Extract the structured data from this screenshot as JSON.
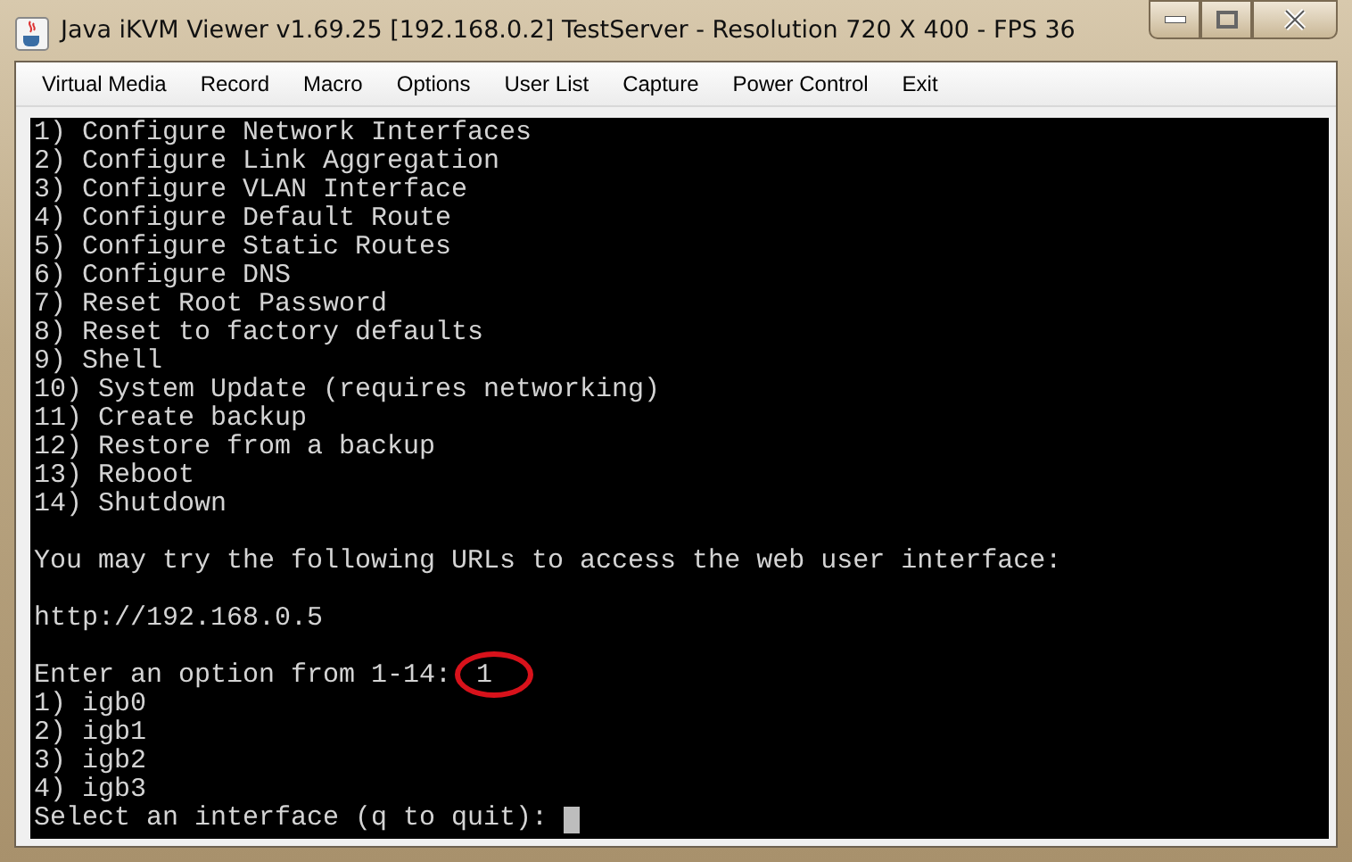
{
  "window": {
    "title": "Java iKVM Viewer v1.69.25 [192.168.0.2] TestServer - Resolution 720 X 400 - FPS 36"
  },
  "menu": [
    "Virtual Media",
    "Record",
    "Macro",
    "Options",
    "User List",
    "Capture",
    "Power Control",
    "Exit"
  ],
  "console": {
    "options": [
      "1) Configure Network Interfaces",
      "2) Configure Link Aggregation",
      "3) Configure VLAN Interface",
      "4) Configure Default Route",
      "5) Configure Static Routes",
      "6) Configure DNS",
      "7) Reset Root Password",
      "8) Reset to factory defaults",
      "9) Shell",
      "10) System Update (requires networking)",
      "11) Create backup",
      "12) Restore from a backup",
      "13) Reboot",
      "14) Shutdown"
    ],
    "message": "You may try the following URLs to access the web user interface:",
    "url": "http://192.168.0.5",
    "prompt": "Enter an option from 1-14:",
    "answer": "1",
    "answer_circled": true,
    "interfaces": [
      "1) igb0",
      "2) igb1",
      "3) igb2",
      "4) igb3"
    ],
    "final_prompt": "Select an interface (q to quit):",
    "cursor": true
  }
}
